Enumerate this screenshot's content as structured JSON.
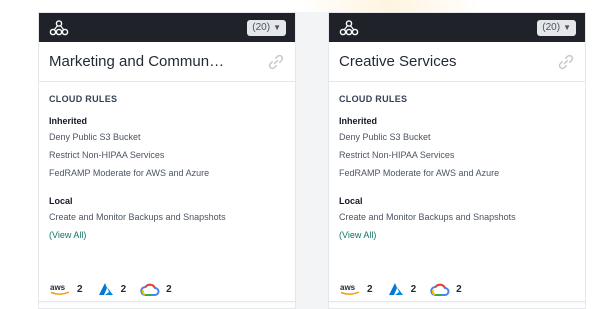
{
  "cards": [
    {
      "count_label": "(20)",
      "title": "Marketing and Commun…",
      "section_label": "CLOUD RULES",
      "inherited_label": "Inherited",
      "inherited": [
        "Deny Public S3 Bucket",
        "Restrict Non-HIPAA Services",
        "FedRAMP Moderate for AWS and Azure"
      ],
      "local_label": "Local",
      "local": [
        "Create and Monitor Backups and Snapshots"
      ],
      "view_all": "(View All)",
      "providers": [
        {
          "icon": "aws-icon",
          "count": "2"
        },
        {
          "icon": "azure-icon",
          "count": "2"
        },
        {
          "icon": "gcp-icon",
          "count": "2"
        }
      ]
    },
    {
      "count_label": "(20)",
      "title": "Creative Services",
      "section_label": "CLOUD RULES",
      "inherited_label": "Inherited",
      "inherited": [
        "Deny Public S3 Bucket",
        "Restrict Non-HIPAA Services",
        "FedRAMP Moderate for AWS and Azure"
      ],
      "local_label": "Local",
      "local": [
        "Create and Monitor Backups and Snapshots"
      ],
      "view_all": "(View All)",
      "providers": [
        {
          "icon": "aws-icon",
          "count": "2"
        },
        {
          "icon": "azure-icon",
          "count": "2"
        },
        {
          "icon": "gcp-icon",
          "count": "2"
        }
      ]
    }
  ],
  "colors": {
    "header_bg": "#1f2329",
    "link": "#0f766e",
    "aws_orange": "#f59e0b",
    "azure_blue": "#0078d4"
  }
}
